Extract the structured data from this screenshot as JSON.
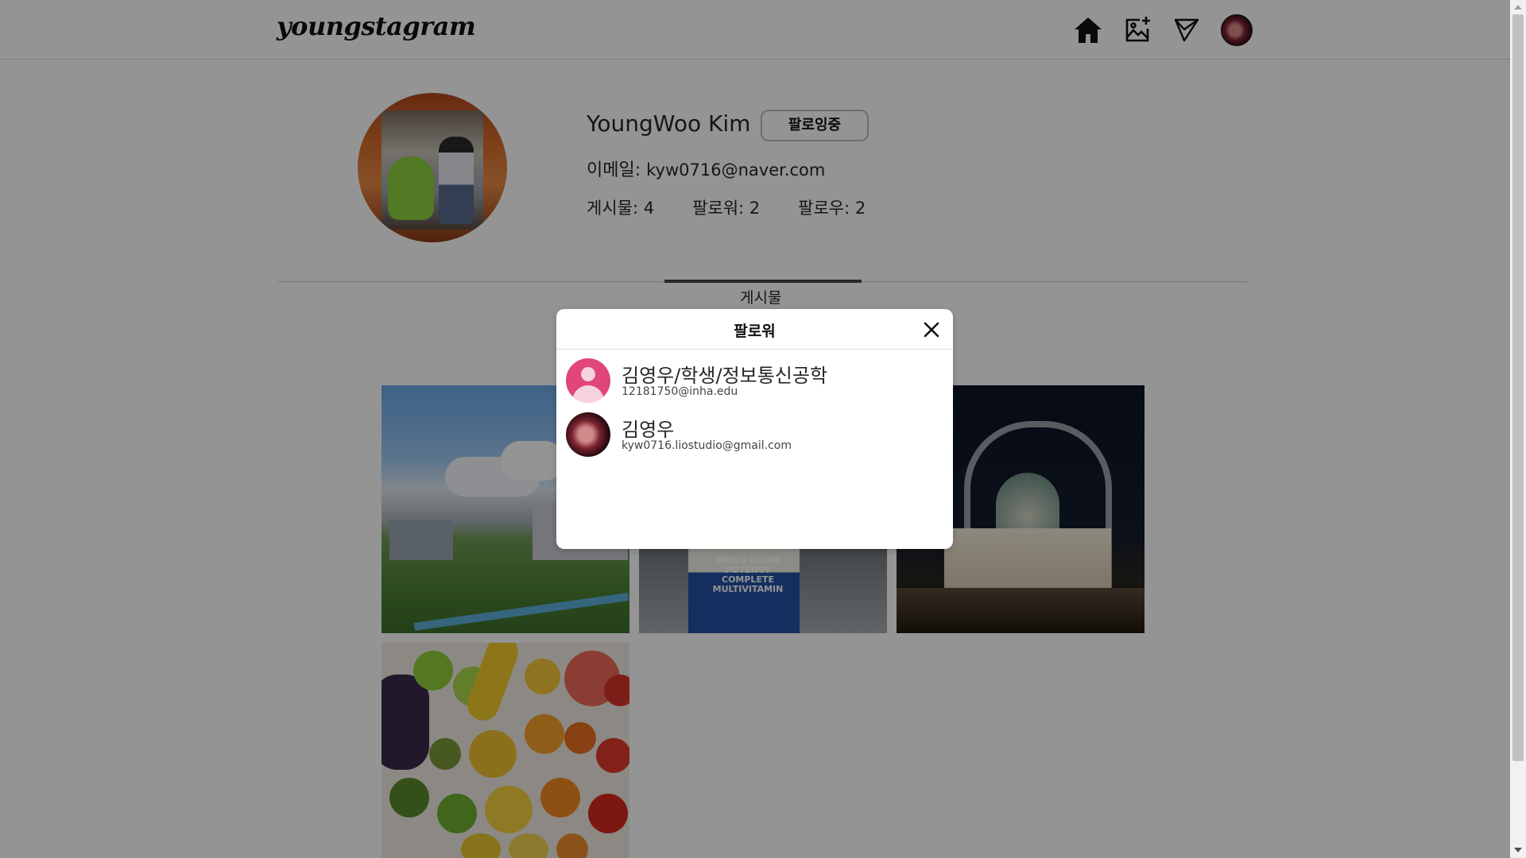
{
  "app": {
    "logo": "youngstagram"
  },
  "nav": {
    "icons": [
      "home-icon",
      "add-photo-icon",
      "direct-message-icon"
    ]
  },
  "profile": {
    "name": "YoungWoo Kim",
    "follow_button": "팔로잉중",
    "email_label": "이메일:",
    "email": "kyw0716@naver.com",
    "posts": "게시물: 4",
    "followers": "팔로워: 2",
    "following": "팔로우: 2"
  },
  "tabs": {
    "posts": "게시물"
  },
  "grid": {
    "bottle_label": "MEN'S ULTRA POTENCY COMPLETE MULTIVITAMIN"
  },
  "modal": {
    "title": "팔로워",
    "users": [
      {
        "name": "김영우/학생/정보통신공학",
        "email": "12181750@inha.edu"
      },
      {
        "name": "김영우",
        "email": "kyw0716.liostudio@gmail.com"
      }
    ]
  },
  "colors": {
    "overlay": "rgba(0,0,0,0.42)",
    "default_avatar": "#e0457b",
    "tab_indicator": "#444444"
  }
}
